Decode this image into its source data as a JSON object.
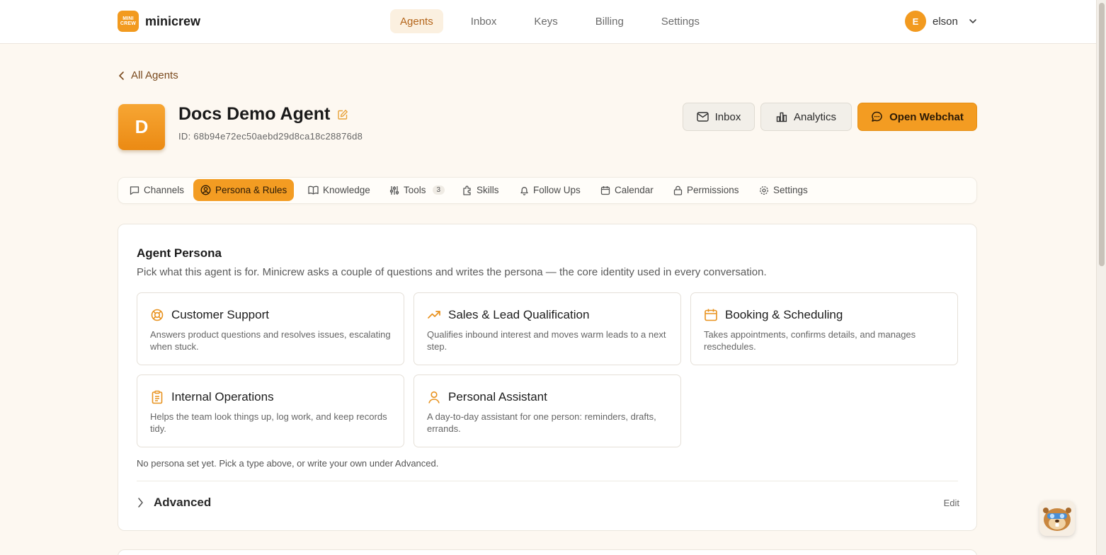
{
  "brand": {
    "logo_top": "MINI",
    "logo_bottom": "CREW",
    "name": "minicrew"
  },
  "nav": {
    "items": [
      {
        "label": "Agents",
        "active": true
      },
      {
        "label": "Inbox"
      },
      {
        "label": "Keys"
      },
      {
        "label": "Billing"
      },
      {
        "label": "Settings"
      }
    ]
  },
  "user": {
    "initial": "E",
    "name": "elson"
  },
  "back": {
    "label": "All Agents"
  },
  "agent": {
    "initial": "D",
    "name": "Docs Demo Agent",
    "id": "ID: 68b94e72ec50aebd29d8ca18c28876d8"
  },
  "actions": {
    "inbox": "Inbox",
    "analytics": "Analytics",
    "webchat": "Open Webchat"
  },
  "tabs": [
    {
      "label": "Channels"
    },
    {
      "label": "Persona & Rules",
      "active": true
    },
    {
      "label": "Knowledge"
    },
    {
      "label": "Tools",
      "badge": "3"
    },
    {
      "label": "Skills"
    },
    {
      "label": "Follow Ups"
    },
    {
      "label": "Calendar"
    },
    {
      "label": "Permissions"
    },
    {
      "label": "Settings"
    }
  ],
  "persona": {
    "title": "Agent Persona",
    "description": "Pick what this agent is for. Minicrew asks a couple of questions and writes the persona — the core identity used in every conversation.",
    "cards": [
      {
        "icon": "lifebuoy-icon",
        "title": "Customer Support",
        "desc": "Answers product questions and resolves issues, escalating when stuck."
      },
      {
        "icon": "trending-up-icon",
        "title": "Sales & Lead Qualification",
        "desc": "Qualifies inbound interest and moves warm leads to a next step."
      },
      {
        "icon": "calendar-icon",
        "title": "Booking & Scheduling",
        "desc": "Takes appointments, confirms details, and manages reschedules."
      },
      {
        "icon": "clipboard-icon",
        "title": "Internal Operations",
        "desc": "Helps the team look things up, log work, and keep records tidy."
      },
      {
        "icon": "user-icon",
        "title": "Personal Assistant",
        "desc": "A day-to-day assistant for one person: reminders, drafts, errands."
      }
    ],
    "hint": "No persona set yet. Pick a type above, or write your own under Advanced.",
    "advanced_label": "Advanced",
    "edit_label": "Edit"
  },
  "colors": {
    "accent": "#f39c22",
    "accent_dark": "#b4651a",
    "background": "#fdf8f1"
  }
}
